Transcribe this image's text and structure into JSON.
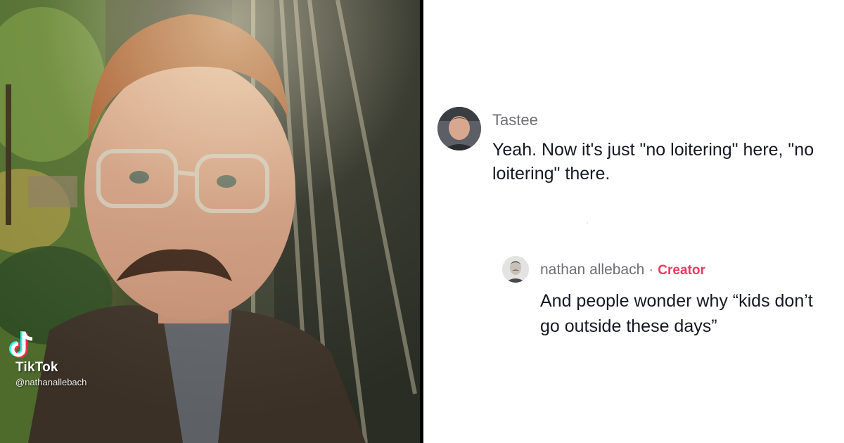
{
  "video": {
    "watermark_brand": "TikTok",
    "watermark_handle": "@nathanallebach",
    "logo_icon": "tiktok-note-icon"
  },
  "comments": [
    {
      "username": "Tastee",
      "text": "Yeah. Now it's just \"no loitering\" here, \"no loitering\" there.",
      "avatar_icon": "user-avatar"
    },
    {
      "username": "nathan allebach",
      "separator": "·",
      "badge": "Creator",
      "text": "And people wonder why “kids don’t go outside these days”",
      "avatar_icon": "creator-avatar"
    }
  ],
  "colors": {
    "creator_badge": "#e8395c",
    "username": "#6f6f74",
    "comment_text": "#161823",
    "divider": "#000000"
  }
}
